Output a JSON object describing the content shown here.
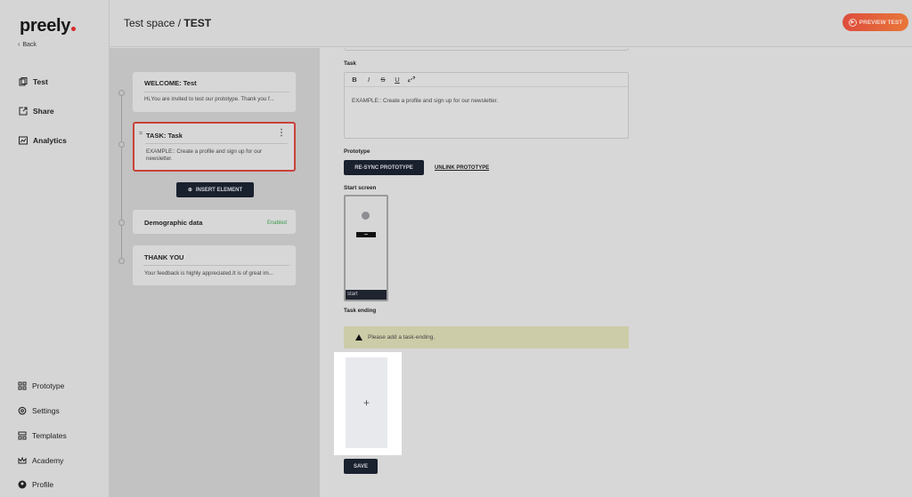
{
  "brand": {
    "logo_text": "preely",
    "back_label": "Back"
  },
  "sidebar": {
    "top_items": [
      {
        "label": "Test",
        "icon": "test-icon"
      },
      {
        "label": "Share",
        "icon": "share-icon"
      },
      {
        "label": "Analytics",
        "icon": "analytics-icon"
      }
    ],
    "bottom_items": [
      {
        "label": "Prototype",
        "icon": "grid-icon"
      },
      {
        "label": "Settings",
        "icon": "gear-icon"
      },
      {
        "label": "Templates",
        "icon": "templates-icon"
      },
      {
        "label": "Academy",
        "icon": "crown-icon"
      },
      {
        "label": "Profile",
        "icon": "profile-icon"
      }
    ]
  },
  "header": {
    "breadcrumb_space": "Test space /",
    "breadcrumb_test": "TEST",
    "preview_label": "PREVIEW TEST"
  },
  "flow": {
    "cards": [
      {
        "title": "WELCOME:  Test",
        "body": "Hi,You are invited to test our prototype. Thank you f..."
      },
      {
        "title": "TASK:  Task",
        "body": "EXAMPLE:: Create a profile and sign up for our newsletter."
      },
      {
        "title": "Demographic data",
        "status": "Enabled"
      },
      {
        "title": "THANK YOU",
        "body": "Your feedback is highly appreciated.It is of great im..."
      }
    ],
    "insert_label": "INSERT ELEMENT"
  },
  "main": {
    "task_label": "Task",
    "toolbar": {
      "bold": "B",
      "italic": "I",
      "strike": "S",
      "underline": "U"
    },
    "task_text": "EXAMPLE:: Create a profile and sign up for our newsletter.",
    "prototype_label": "Prototype",
    "resync_label": "RE-SYNC PROTOTYPE",
    "unlink_label": "UNLINK PROTOTYPE",
    "start_screen_label": "Start screen",
    "start_screen_name": "start",
    "task_ending_label": "Task ending",
    "warning_text": "Please add a task-ending.",
    "add_symbol": "+",
    "save_label": "SAVE"
  },
  "colors": {
    "accent_gradient_start": "#de4d3c",
    "accent_gradient_end": "#e8773a",
    "dark_button": "#19202e",
    "active_border": "#c9413a",
    "enabled_green": "#3d9a4a",
    "warning_bg": "#cdcca8"
  }
}
